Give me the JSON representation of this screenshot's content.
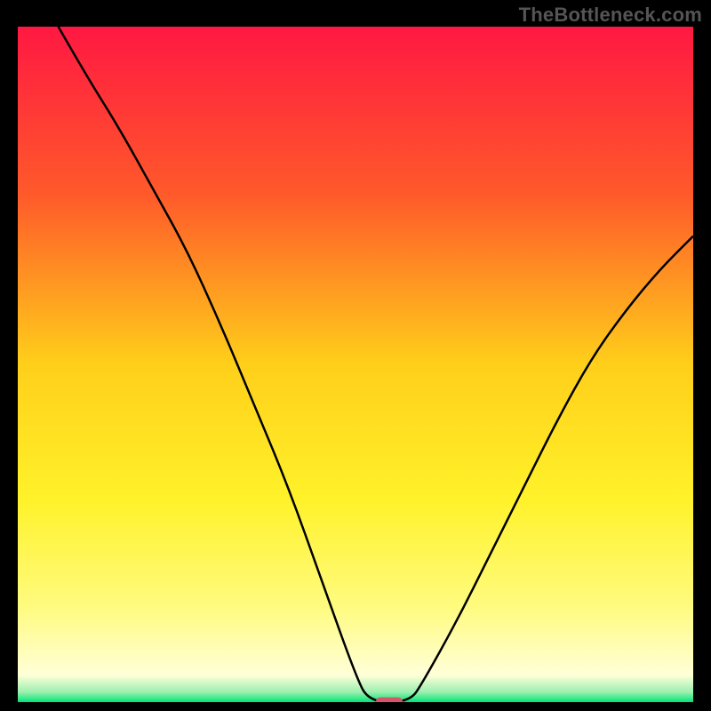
{
  "watermark": {
    "text": "TheBottleneck.com"
  },
  "chart_data": {
    "type": "line",
    "title": "",
    "xlabel": "",
    "ylabel": "",
    "xlim": [
      0,
      100
    ],
    "ylim": [
      0,
      100
    ],
    "grid": false,
    "legend": false,
    "background_gradient": {
      "stops": [
        {
          "offset": 0.0,
          "color": "#ff1842"
        },
        {
          "offset": 0.25,
          "color": "#ff5a2a"
        },
        {
          "offset": 0.5,
          "color": "#ffcf1a"
        },
        {
          "offset": 0.7,
          "color": "#fff22a"
        },
        {
          "offset": 0.86,
          "color": "#fffb80"
        },
        {
          "offset": 0.96,
          "color": "#ffffd8"
        },
        {
          "offset": 0.985,
          "color": "#9cf0b0"
        },
        {
          "offset": 1.0,
          "color": "#00e676"
        }
      ]
    },
    "marker": {
      "x": 55,
      "y": 0,
      "color": "#d9546a",
      "w": 4,
      "h": 1.4
    },
    "curve": [
      {
        "x": 6,
        "y": 100
      },
      {
        "x": 10,
        "y": 93
      },
      {
        "x": 15,
        "y": 85
      },
      {
        "x": 20,
        "y": 76
      },
      {
        "x": 25,
        "y": 67
      },
      {
        "x": 30,
        "y": 56
      },
      {
        "x": 35,
        "y": 44
      },
      {
        "x": 40,
        "y": 32
      },
      {
        "x": 45,
        "y": 18
      },
      {
        "x": 50,
        "y": 4
      },
      {
        "x": 52,
        "y": 0
      },
      {
        "x": 58,
        "y": 0
      },
      {
        "x": 60,
        "y": 3
      },
      {
        "x": 65,
        "y": 12
      },
      {
        "x": 70,
        "y": 22
      },
      {
        "x": 75,
        "y": 32
      },
      {
        "x": 80,
        "y": 42
      },
      {
        "x": 85,
        "y": 51
      },
      {
        "x": 90,
        "y": 58
      },
      {
        "x": 95,
        "y": 64
      },
      {
        "x": 100,
        "y": 69
      }
    ]
  }
}
